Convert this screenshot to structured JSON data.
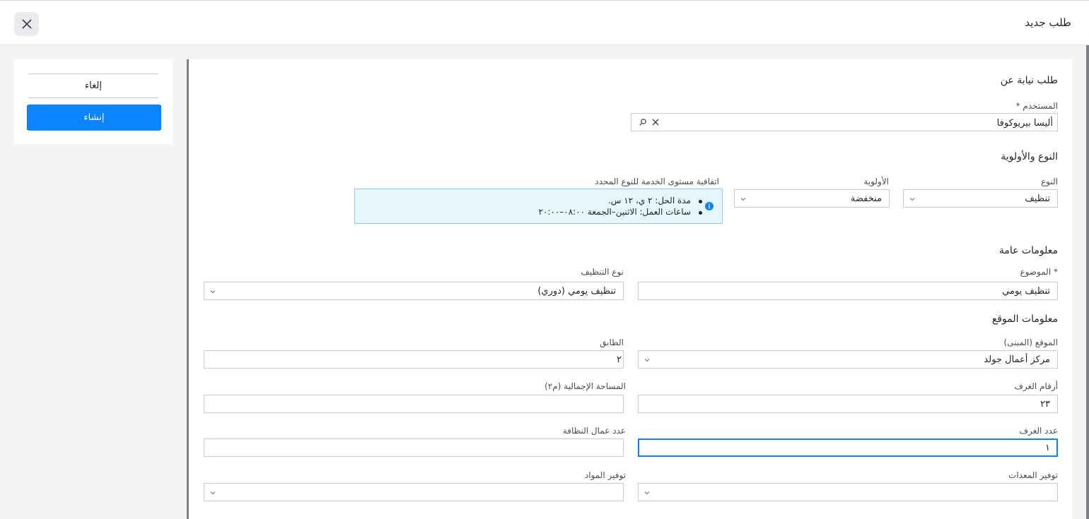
{
  "header": {
    "title": "طلب جديد"
  },
  "actions": {
    "cancel_label": "إلغاء",
    "create_label": "إنشاء"
  },
  "form": {
    "on_behalf": {
      "section_title": "طلب نيابة عن",
      "user_label": "المستخدم *",
      "user_value": "أليسا بيريوكوفا"
    },
    "type_priority": {
      "section_title": "النوع والأولوية",
      "type_label": "النوع",
      "type_value": "تنظيف",
      "priority_label": "الأولوية",
      "priority_value": "منخفضة",
      "sla_label": "اتفاقية مستوى الخدمة للنوع المحدد",
      "sla_line1": "مدة الحل: ٢ ي، ١٢ س.",
      "sla_line2": "ساعات العمل: الاثنين–الجمعة ٠٨:٠٠–٢٠:٠٠"
    },
    "general": {
      "section_title": "معلومات عامة",
      "subject_label": "* الموضوع",
      "subject_value": "تنظيف يومي",
      "cleaning_type_label": "نوع التنظيف",
      "cleaning_type_value": "تنظيف يومي (دوري)"
    },
    "location": {
      "section_title": "معلومات الموقع",
      "building_label": "الموقع (المبنى)",
      "building_value": "مركز أعمال جولد",
      "floor_label": "الطابق",
      "floor_value": "٢",
      "rooms_label": "أرقام الغرف",
      "rooms_value": "٢٣",
      "area_label": "المساحة الإجمالية (م٢)",
      "area_value": "",
      "room_count_label": "عدد الغرف",
      "room_count_value": "١",
      "cleaners_label": "عدد عمال النظافة",
      "cleaners_value": "",
      "equipment_label": "توفير المعدات",
      "materials_label": "توفير المواد"
    }
  },
  "colors": {
    "accent": "#0a84ff",
    "sla_bg": "#e6f6fd",
    "sla_border": "#8fd0f3",
    "info": "#0a84ff"
  }
}
